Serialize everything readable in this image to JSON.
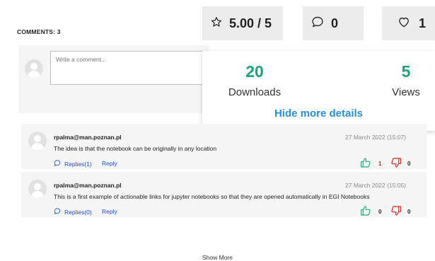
{
  "comments_header": "COMMENTS: 3",
  "comment_input": {
    "placeholder": "Write a comment..."
  },
  "stats": {
    "rating": "5.00 / 5",
    "comments": "0",
    "likes": "1"
  },
  "details": {
    "downloads_value": "20",
    "downloads_label": "Downloads",
    "views_value": "5",
    "views_label": "Views",
    "hide_label": "Hide more details"
  },
  "comments": [
    {
      "author": "rpalma@man.poznan.pl",
      "date": "27 March 2022 (15:07)",
      "text": "The idea is that the notebook can be originally in any location",
      "replies": "Replies(1)",
      "reply": "Reply",
      "upvotes": "1",
      "downvotes": "0"
    },
    {
      "author": "rpalma@man.poznan.pl",
      "date": "27 March 2022 (15:05)",
      "text": "This is a first example of actionable links for jupyter notebooks so that they are opened automatically in EGI Notebooks",
      "replies": "Replies(0)",
      "reply": "Reply",
      "upvotes": "0",
      "downvotes": "0"
    }
  ],
  "show_more": "Show More",
  "colors": {
    "accent_green": "#19a57d",
    "link_blue": "#2a8fd6",
    "thumb_up": "#19b07a",
    "thumb_down": "#e02020"
  },
  "icons": {
    "rating": "star-icon",
    "comments": "speech-bubble-icon",
    "likes": "heart-icon",
    "upvote": "thumbs-up-icon",
    "downvote": "thumbs-down-icon"
  }
}
